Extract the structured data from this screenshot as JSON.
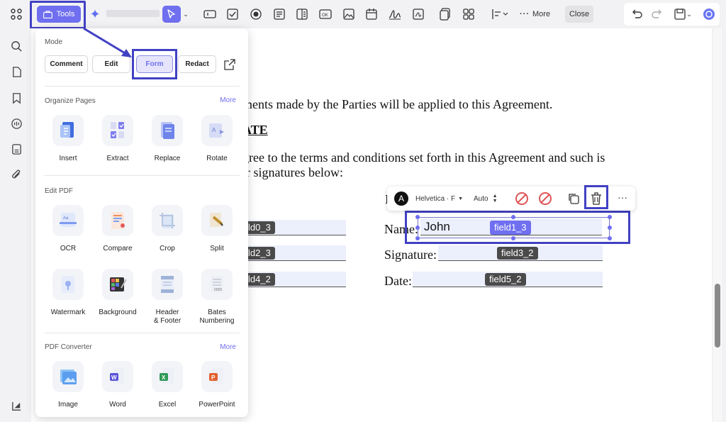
{
  "toolbar": {
    "tools_label": "Tools",
    "more_label": "More",
    "close_label": "Close"
  },
  "panel": {
    "mode_heading": "Mode",
    "modes": [
      "Comment",
      "Edit",
      "Form",
      "Redact"
    ],
    "organize_heading": "Organize Pages",
    "organize_more": "More",
    "organize_tools": [
      "Insert",
      "Extract",
      "Replace",
      "Rotate"
    ],
    "edit_heading": "Edit PDF",
    "edit_tools_row1": [
      "OCR",
      "Compare",
      "Crop",
      "Split"
    ],
    "edit_tools_row2": [
      "Watermark",
      "Background",
      "Header\n& Footer",
      "Bates\nNumbering"
    ],
    "converter_heading": "PDF Converter",
    "converter_more": "More",
    "converter_tools": [
      "Image",
      "Word",
      "Excel",
      "PowerPoint"
    ]
  },
  "document": {
    "line1": "ments made by the Parties will be applied to this Agreement.",
    "line2": "ATE",
    "line3": "gree to the terms and conditions set forth in this Agreement and such is",
    "line4": "ir signatures below:",
    "letter_l": "L",
    "name_label": "Name:",
    "signature_label": "Signature:",
    "date_label": "Date:",
    "left_fields": [
      "ld0_3",
      "ld2_3",
      "ld4_2"
    ],
    "field1_value": "John",
    "field1_tag": "field1_3",
    "field3_tag": "field3_2",
    "field5_tag": "field5_2"
  },
  "field_toolbar": {
    "avatar_letter": "A",
    "font_label": "Helvetica · F",
    "size_label": "Auto"
  },
  "colors": {
    "accent": "#6f6ff0",
    "highlight": "#4141c4",
    "field_bg": "#eceffc"
  }
}
